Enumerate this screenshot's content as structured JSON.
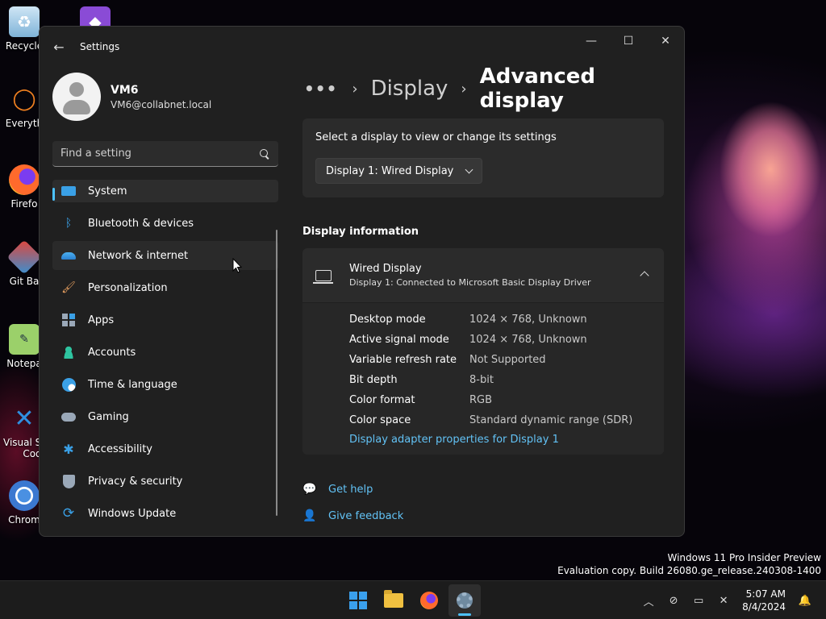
{
  "desktop": {
    "icons": [
      {
        "label": "Recycle",
        "icon": "recycle-bin-icon"
      },
      {
        "label": "",
        "icon": "visual-studio-icon"
      },
      {
        "label": "Everyth",
        "icon": "everything-search-icon"
      },
      {
        "label": "Firefo",
        "icon": "firefox-icon"
      },
      {
        "label": "Git Ba",
        "icon": "git-bash-icon"
      },
      {
        "label": "Notepa",
        "icon": "notepad-plus-plus-icon"
      },
      {
        "label": "Visual St",
        "label2": "Cod",
        "icon": "vscode-icon"
      },
      {
        "label": "Chrom",
        "icon": "chrome-icon"
      }
    ],
    "watermark": {
      "line1": "Windows 11 Pro Insider Preview",
      "line2": "Evaluation copy. Build 26080.ge_release.240308-1400"
    }
  },
  "window": {
    "title": "Settings",
    "caption": {
      "minimize": "—",
      "maximize": "☐",
      "close": "✕"
    }
  },
  "profile": {
    "name": "VM6",
    "email": "VM6@collabnet.local"
  },
  "search": {
    "placeholder": "Find a setting"
  },
  "sidebar": {
    "items": [
      {
        "label": "System",
        "icon": "system-display-icon",
        "selected": true
      },
      {
        "label": "Bluetooth & devices",
        "icon": "bluetooth-icon"
      },
      {
        "label": "Network & internet",
        "icon": "wifi-icon",
        "hover": true
      },
      {
        "label": "Personalization",
        "icon": "paint-brush-icon"
      },
      {
        "label": "Apps",
        "icon": "apps-icon"
      },
      {
        "label": "Accounts",
        "icon": "person-icon"
      },
      {
        "label": "Time & language",
        "icon": "globe-clock-icon"
      },
      {
        "label": "Gaming",
        "icon": "gamepad-icon"
      },
      {
        "label": "Accessibility",
        "icon": "accessibility-icon"
      },
      {
        "label": "Privacy & security",
        "icon": "shield-icon"
      },
      {
        "label": "Windows Update",
        "icon": "update-sync-icon"
      }
    ]
  },
  "breadcrumb": {
    "more": "•••",
    "parent": "Display",
    "current": "Advanced display"
  },
  "select_display": {
    "caption": "Select a display to view or change its settings",
    "selected": "Display 1: Wired Display"
  },
  "display_info": {
    "section_title": "Display information",
    "title": "Wired Display",
    "subtitle": "Display 1: Connected to Microsoft Basic Display Driver",
    "rows": [
      {
        "label": "Desktop mode",
        "value": "1024 × 768, Unknown"
      },
      {
        "label": "Active signal mode",
        "value": "1024 × 768, Unknown"
      },
      {
        "label": "Variable refresh rate",
        "value": "Not Supported"
      },
      {
        "label": "Bit depth",
        "value": "8-bit"
      },
      {
        "label": "Color format",
        "value": "RGB"
      },
      {
        "label": "Color space",
        "value": "Standard dynamic range (SDR)"
      }
    ],
    "adapter_link": "Display adapter properties for Display 1"
  },
  "help": {
    "get_help": "Get help",
    "give_feedback": "Give feedback"
  },
  "taskbar": {
    "apps": [
      "start-icon",
      "file-explorer-icon",
      "firefox-icon",
      "settings-gear-icon"
    ],
    "clock": {
      "time": "5:07 AM",
      "date": "8/4/2024"
    }
  },
  "colors": {
    "accent": "#4cc2ff",
    "link": "#62c2f5",
    "window_bg": "#202020",
    "card_bg": "#2b2b2b"
  }
}
